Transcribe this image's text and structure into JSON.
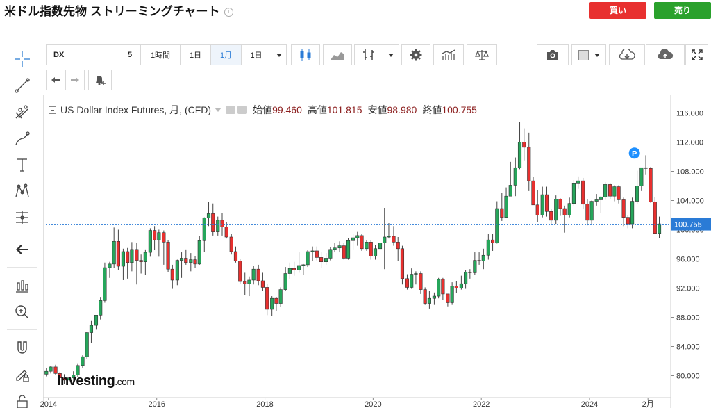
{
  "header": {
    "title": "米ドル指数先物 ストリーミングチャート",
    "buy_label": "買い",
    "sell_label": "売り"
  },
  "toolbar": {
    "symbol": "DX",
    "interval_num": "5",
    "range_1h": "1時間",
    "range_1d": "1日",
    "range_1m": "1月",
    "range_1d_select": "1日"
  },
  "legend": {
    "name": "US Dollar Index Futures, 月, (CFD)",
    "open_label": "始値",
    "open": "99.460",
    "high_label": "高値",
    "high": "101.815",
    "low_label": "安値",
    "low": "98.980",
    "close_label": "終値",
    "close": "100.755"
  },
  "logo": {
    "brand": "Investing",
    "domain": ".com"
  },
  "colors": {
    "up": "#26a65b",
    "down": "#e8302f",
    "price_tag": "#2a7bd6",
    "marker": "#1e90ff"
  },
  "chart_data": {
    "type": "candlestick",
    "title": "US Dollar Index Futures, 月, (CFD)",
    "y_ticks": [
      "116.000",
      "112.000",
      "108.000",
      "104.000",
      "100.000",
      "96.000",
      "92.000",
      "88.000",
      "84.000",
      "80.000"
    ],
    "ylim": [
      77.0,
      117.0
    ],
    "x_ticks": [
      "2014",
      "2016",
      "2018",
      "2020",
      "2022",
      "2024",
      "2月"
    ],
    "x_tick_positions": [
      2014.0,
      2016.0,
      2018.0,
      2020.0,
      2022.0,
      2024.0,
      2025.08
    ],
    "xlim": [
      2013.95,
      2025.45
    ],
    "current_price": "100.755",
    "marker_label": "P",
    "marker_point": {
      "t": 2024.83,
      "y": 110.5
    },
    "candles": [
      [
        2013.96,
        80.2,
        81.0,
        79.9,
        80.6
      ],
      [
        2014.04,
        80.6,
        81.3,
        80.3,
        81.2
      ],
      [
        2014.13,
        81.2,
        81.5,
        80.1,
        80.3
      ],
      [
        2014.21,
        80.3,
        80.5,
        79.3,
        79.7
      ],
      [
        2014.29,
        79.7,
        80.2,
        78.9,
        79.4
      ],
      [
        2014.38,
        79.4,
        80.1,
        79.0,
        79.7
      ],
      [
        2014.46,
        79.7,
        80.6,
        79.5,
        80.1
      ],
      [
        2014.54,
        80.1,
        81.7,
        79.8,
        81.4
      ],
      [
        2014.63,
        81.4,
        82.8,
        81.1,
        82.6
      ],
      [
        2014.71,
        82.6,
        86.0,
        82.3,
        85.9
      ],
      [
        2014.79,
        85.9,
        87.5,
        84.5,
        86.9
      ],
      [
        2014.88,
        86.9,
        88.3,
        86.3,
        88.3
      ],
      [
        2014.96,
        88.3,
        90.7,
        87.7,
        90.3
      ],
      [
        2015.04,
        90.3,
        95.5,
        90.0,
        94.8
      ],
      [
        2015.13,
        94.8,
        95.6,
        93.4,
        95.3
      ],
      [
        2015.21,
        95.3,
        100.3,
        94.8,
        98.4
      ],
      [
        2015.29,
        98.4,
        100.0,
        94.5,
        95.0
      ],
      [
        2015.38,
        95.0,
        97.4,
        93.1,
        97.0
      ],
      [
        2015.46,
        97.0,
        97.5,
        93.3,
        95.5
      ],
      [
        2015.54,
        95.5,
        98.3,
        94.3,
        97.3
      ],
      [
        2015.63,
        97.3,
        98.2,
        92.5,
        95.8
      ],
      [
        2015.71,
        95.8,
        96.6,
        94.0,
        95.6
      ],
      [
        2015.79,
        95.6,
        97.3,
        93.8,
        96.9
      ],
      [
        2015.88,
        96.9,
        100.2,
        96.3,
        99.9
      ],
      [
        2015.96,
        99.9,
        100.5,
        97.2,
        98.6
      ],
      [
        2016.04,
        98.6,
        100.0,
        96.3,
        99.6
      ],
      [
        2016.13,
        99.6,
        99.9,
        95.2,
        98.3
      ],
      [
        2016.21,
        98.3,
        98.6,
        94.2,
        94.6
      ],
      [
        2016.29,
        94.6,
        95.2,
        91.9,
        93.1
      ],
      [
        2016.38,
        93.1,
        95.9,
        92.4,
        95.8
      ],
      [
        2016.46,
        95.8,
        96.9,
        93.4,
        96.1
      ],
      [
        2016.54,
        96.1,
        97.3,
        95.2,
        95.5
      ],
      [
        2016.63,
        95.5,
        96.8,
        94.3,
        95.9
      ],
      [
        2016.71,
        95.9,
        96.4,
        94.8,
        95.3
      ],
      [
        2016.79,
        95.3,
        99.1,
        95.2,
        98.5
      ],
      [
        2016.88,
        98.5,
        101.7,
        97.0,
        101.6
      ],
      [
        2016.96,
        101.6,
        103.8,
        100.5,
        102.2
      ],
      [
        2017.04,
        102.2,
        103.6,
        99.2,
        99.7
      ],
      [
        2017.13,
        99.7,
        101.8,
        99.2,
        101.3
      ],
      [
        2017.21,
        101.3,
        102.3,
        99.2,
        100.4
      ],
      [
        2017.29,
        100.4,
        101.0,
        98.8,
        99.0
      ],
      [
        2017.38,
        99.0,
        99.4,
        96.6,
        97.0
      ],
      [
        2017.46,
        97.0,
        97.7,
        95.5,
        95.7
      ],
      [
        2017.54,
        95.7,
        96.0,
        92.6,
        92.9
      ],
      [
        2017.63,
        92.9,
        94.1,
        91.0,
        92.6
      ],
      [
        2017.71,
        92.6,
        93.6,
        90.9,
        93.1
      ],
      [
        2017.79,
        93.1,
        95.0,
        92.5,
        94.6
      ],
      [
        2017.88,
        94.6,
        95.2,
        92.4,
        93.0
      ],
      [
        2017.96,
        93.0,
        94.1,
        91.6,
        92.1
      ],
      [
        2018.04,
        92.1,
        92.6,
        88.3,
        89.1
      ],
      [
        2018.13,
        89.1,
        90.9,
        88.2,
        90.6
      ],
      [
        2018.21,
        90.6,
        90.8,
        88.9,
        89.9
      ],
      [
        2018.29,
        89.9,
        92.1,
        89.4,
        91.8
      ],
      [
        2018.38,
        91.8,
        94.9,
        91.6,
        94.0
      ],
      [
        2018.46,
        94.0,
        95.5,
        93.2,
        94.7
      ],
      [
        2018.54,
        94.7,
        95.6,
        93.7,
        94.5
      ],
      [
        2018.63,
        94.5,
        96.9,
        94.1,
        95.1
      ],
      [
        2018.71,
        95.1,
        95.3,
        93.8,
        95.2
      ],
      [
        2018.79,
        95.2,
        97.2,
        94.9,
        97.0
      ],
      [
        2018.88,
        97.0,
        97.7,
        95.7,
        97.1
      ],
      [
        2018.96,
        97.1,
        97.7,
        95.8,
        96.2
      ],
      [
        2019.04,
        96.2,
        96.9,
        94.8,
        95.6
      ],
      [
        2019.13,
        95.6,
        96.8,
        95.2,
        96.1
      ],
      [
        2019.21,
        96.1,
        97.6,
        95.8,
        97.3
      ],
      [
        2019.29,
        97.3,
        98.2,
        96.9,
        97.5
      ],
      [
        2019.38,
        97.5,
        98.4,
        96.9,
        97.8
      ],
      [
        2019.46,
        97.8,
        98.2,
        95.9,
        96.1
      ],
      [
        2019.54,
        96.1,
        98.9,
        95.9,
        98.5
      ],
      [
        2019.63,
        98.5,
        99.4,
        97.3,
        98.9
      ],
      [
        2019.71,
        98.9,
        99.7,
        97.8,
        99.2
      ],
      [
        2019.79,
        99.2,
        99.4,
        97.1,
        97.4
      ],
      [
        2019.88,
        97.4,
        98.6,
        97.1,
        98.3
      ],
      [
        2019.96,
        98.3,
        98.6,
        95.9,
        96.4
      ],
      [
        2020.04,
        96.4,
        97.9,
        95.9,
        97.4
      ],
      [
        2020.13,
        97.4,
        99.9,
        97.2,
        98.2
      ],
      [
        2020.21,
        98.2,
        103.0,
        94.6,
        99.0
      ],
      [
        2020.29,
        99.0,
        100.9,
        98.8,
        99.1
      ],
      [
        2020.38,
        99.1,
        100.5,
        97.8,
        98.3
      ],
      [
        2020.46,
        98.3,
        99.0,
        95.7,
        97.4
      ],
      [
        2020.54,
        97.4,
        97.8,
        92.5,
        93.3
      ],
      [
        2020.63,
        93.3,
        93.9,
        91.8,
        92.1
      ],
      [
        2020.71,
        92.1,
        94.7,
        91.9,
        93.9
      ],
      [
        2020.79,
        93.9,
        94.3,
        92.5,
        94.0
      ],
      [
        2020.88,
        94.0,
        94.3,
        91.2,
        91.8
      ],
      [
        2020.96,
        91.8,
        92.1,
        89.7,
        89.9
      ],
      [
        2021.04,
        89.9,
        91.6,
        89.2,
        90.6
      ],
      [
        2021.13,
        90.6,
        91.4,
        89.7,
        90.9
      ],
      [
        2021.21,
        90.9,
        93.4,
        90.6,
        93.2
      ],
      [
        2021.29,
        93.2,
        93.4,
        90.4,
        91.2
      ],
      [
        2021.38,
        91.2,
        91.2,
        89.5,
        90.0
      ],
      [
        2021.46,
        90.0,
        92.8,
        89.7,
        92.3
      ],
      [
        2021.54,
        92.3,
        93.0,
        91.3,
        92.0
      ],
      [
        2021.63,
        92.0,
        93.7,
        91.8,
        92.6
      ],
      [
        2021.71,
        92.6,
        94.5,
        91.9,
        94.2
      ],
      [
        2021.79,
        94.2,
        94.6,
        93.3,
        94.1
      ],
      [
        2021.88,
        94.1,
        96.9,
        93.8,
        95.8
      ],
      [
        2021.96,
        95.8,
        96.9,
        95.2,
        95.7
      ],
      [
        2022.04,
        95.7,
        97.4,
        94.6,
        96.5
      ],
      [
        2022.13,
        96.5,
        99.4,
        95.9,
        98.6
      ],
      [
        2022.21,
        98.6,
        99.4,
        97.1,
        98.2
      ],
      [
        2022.29,
        98.2,
        103.9,
        98.1,
        102.9
      ],
      [
        2022.38,
        102.9,
        105.0,
        101.2,
        101.7
      ],
      [
        2022.46,
        101.7,
        105.8,
        101.6,
        104.6
      ],
      [
        2022.54,
        104.6,
        109.3,
        104.6,
        106.1
      ],
      [
        2022.63,
        106.1,
        109.9,
        104.6,
        108.5
      ],
      [
        2022.71,
        108.5,
        114.8,
        108.3,
        112.0
      ],
      [
        2022.79,
        112.0,
        113.9,
        109.5,
        111.3
      ],
      [
        2022.88,
        111.3,
        113.3,
        105.3,
        106.7
      ],
      [
        2022.96,
        106.7,
        107.2,
        103.4,
        103.4
      ],
      [
        2023.04,
        103.4,
        105.4,
        101.0,
        102.0
      ],
      [
        2023.13,
        102.0,
        105.9,
        101.7,
        104.8
      ],
      [
        2023.21,
        104.8,
        105.9,
        101.8,
        102.5
      ],
      [
        2023.29,
        102.5,
        102.9,
        100.8,
        101.3
      ],
      [
        2023.38,
        101.3,
        104.7,
        100.8,
        104.2
      ],
      [
        2023.46,
        104.2,
        104.3,
        101.9,
        102.9
      ],
      [
        2023.54,
        102.9,
        103.3,
        99.6,
        102.0
      ],
      [
        2023.63,
        102.0,
        104.4,
        101.7,
        103.6
      ],
      [
        2023.71,
        103.6,
        106.8,
        103.3,
        106.3
      ],
      [
        2023.79,
        106.3,
        107.3,
        105.6,
        106.7
      ],
      [
        2023.88,
        106.7,
        107.1,
        102.8,
        103.5
      ],
      [
        2023.96,
        103.5,
        104.2,
        100.6,
        101.3
      ],
      [
        2024.04,
        101.3,
        104.0,
        100.8,
        103.9
      ],
      [
        2024.13,
        103.9,
        104.9,
        103.3,
        104.1
      ],
      [
        2024.21,
        104.1,
        104.6,
        102.3,
        104.5
      ],
      [
        2024.29,
        104.5,
        106.5,
        104.1,
        106.2
      ],
      [
        2024.38,
        106.2,
        106.4,
        104.2,
        104.6
      ],
      [
        2024.46,
        104.6,
        106.1,
        103.9,
        105.9
      ],
      [
        2024.54,
        105.9,
        106.1,
        103.6,
        104.1
      ],
      [
        2024.63,
        104.1,
        104.4,
        100.5,
        101.7
      ],
      [
        2024.71,
        101.7,
        102.0,
        100.2,
        100.8
      ],
      [
        2024.79,
        100.8,
        104.4,
        100.2,
        103.9
      ],
      [
        2024.88,
        103.9,
        108.1,
        103.5,
        106.0
      ],
      [
        2024.96,
        106.0,
        108.5,
        105.3,
        108.5
      ],
      [
        2025.04,
        108.5,
        110.2,
        107.5,
        108.4
      ],
      [
        2025.13,
        108.4,
        108.6,
        103.7,
        103.8
      ],
      [
        2025.21,
        103.8,
        104.5,
        99.4,
        99.5
      ],
      [
        2025.29,
        99.5,
        101.8,
        98.9,
        100.8
      ]
    ]
  }
}
